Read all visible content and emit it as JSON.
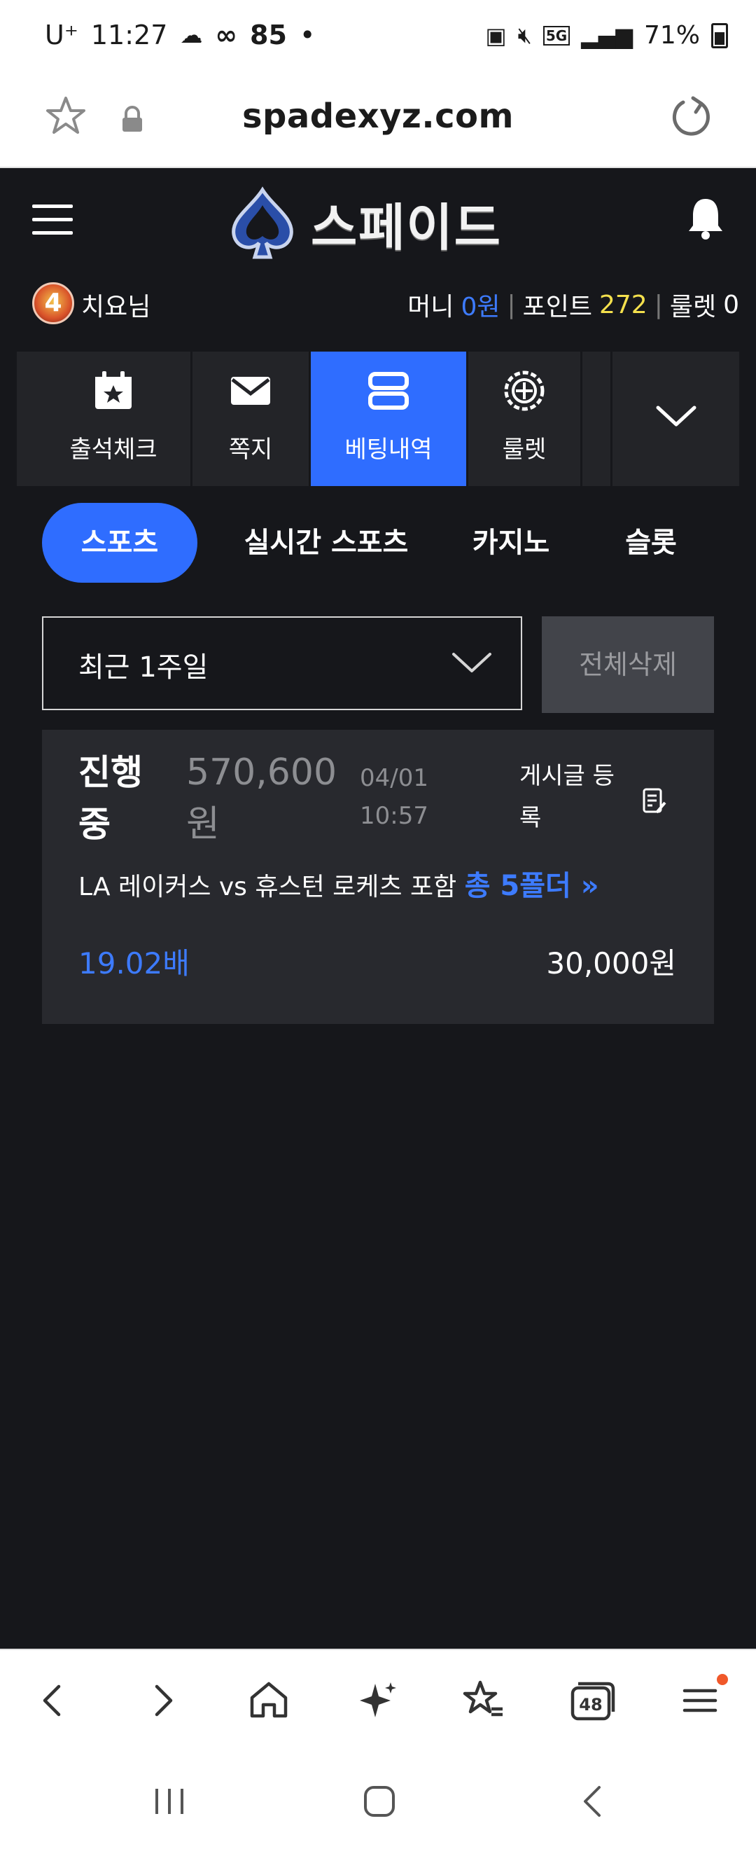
{
  "status_bar": {
    "carrier": "U⁺",
    "time": "11:27",
    "extra": "85",
    "battery": "71%",
    "network": "5G"
  },
  "url_bar": {
    "url": "spadexyz.com"
  },
  "header": {
    "logo_text": "스페이드"
  },
  "user": {
    "level": "4",
    "name": "치요님",
    "money_label": "머니",
    "money_value": "0원",
    "point_label": "포인트",
    "point_value": "272",
    "roulette_label": "룰렛",
    "roulette_value": "0"
  },
  "quick_menu": [
    {
      "label": "출석체크",
      "icon": "calendar-star-icon"
    },
    {
      "label": "쪽지",
      "icon": "mail-icon"
    },
    {
      "label": "베팅내역",
      "icon": "list-icon",
      "active": true
    },
    {
      "label": "룰렛",
      "icon": "roulette-icon"
    }
  ],
  "categories": [
    {
      "label": "스포츠",
      "active": true
    },
    {
      "label": "실시간 스포츠"
    },
    {
      "label": "카지노"
    },
    {
      "label": "슬롯"
    }
  ],
  "filter": {
    "period": "최근 1주일",
    "delete_all": "전체삭제"
  },
  "bet": {
    "status_line1": "진행",
    "status_line2": "중",
    "amount_line1": "570,600",
    "amount_line2": "원",
    "date": "04/01",
    "time": "10:57",
    "post_line1": "게시글 등",
    "post_line2": "록",
    "match": "LA 레이커스 vs 휴스턴 로케츠 포함",
    "folder": "총 5폴더 »",
    "odds": "19.02배",
    "stake": "30,000원"
  },
  "browser_bar": {
    "tabs_count": "48"
  },
  "colors": {
    "background": "#16171b",
    "accent": "#2f6dff",
    "card": "#28292e",
    "point": "#f4e04d"
  }
}
